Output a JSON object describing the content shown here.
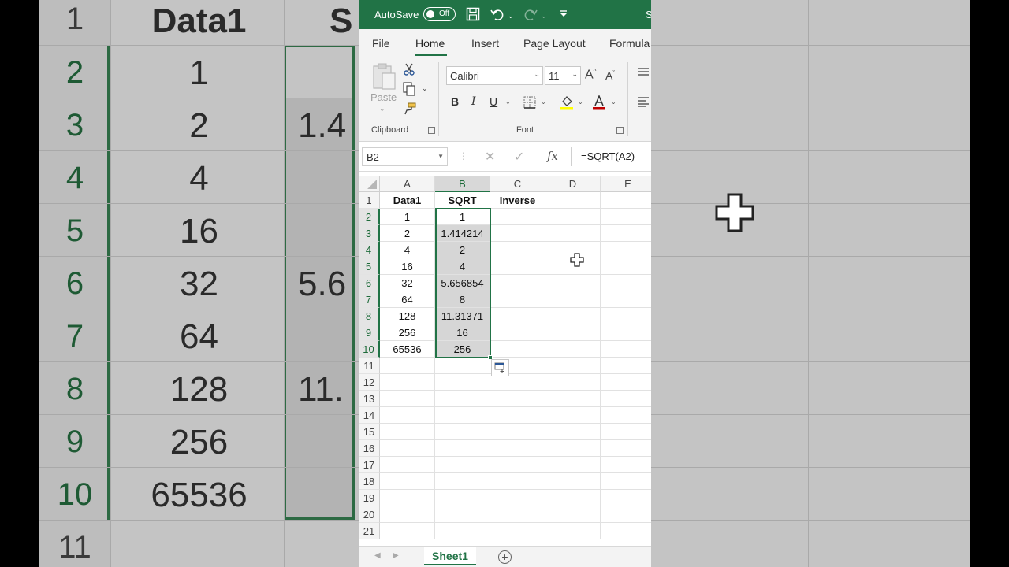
{
  "titlebar": {
    "autosave_label": "AutoSave",
    "toggle_state": "Off",
    "title_fragment": "S"
  },
  "tabs": [
    {
      "label": "File"
    },
    {
      "label": "Home"
    },
    {
      "label": "Insert"
    },
    {
      "label": "Page Layout"
    },
    {
      "label": "Formula"
    }
  ],
  "ribbon": {
    "paste_label": "Paste",
    "clipboard_label": "Clipboard",
    "font_label": "Font",
    "font_name": "Calibri",
    "font_size": "11",
    "bold": "B",
    "italic": "I",
    "underline": "U",
    "grow_font": "A",
    "shrink_font": "A"
  },
  "formula_bar": {
    "name_box": "B2",
    "fx": "fx",
    "formula": "=SQRT(A2)"
  },
  "grid": {
    "columns": [
      "A",
      "B",
      "C",
      "D",
      "E"
    ],
    "rows": [
      "1",
      "2",
      "3",
      "4",
      "5",
      "6",
      "7",
      "8",
      "9",
      "10",
      "11",
      "12",
      "13",
      "14",
      "15",
      "16",
      "17",
      "18",
      "19",
      "20",
      "21"
    ],
    "headers": [
      "Data1",
      "SQRT",
      "Inverse"
    ],
    "data": [
      [
        "1",
        "1"
      ],
      [
        "2",
        "1.414214"
      ],
      [
        "4",
        "2"
      ],
      [
        "16",
        "4"
      ],
      [
        "32",
        "5.656854"
      ],
      [
        "64",
        "8"
      ],
      [
        "128",
        "11.31371"
      ],
      [
        "256",
        "16"
      ],
      [
        "65536",
        "256"
      ]
    ]
  },
  "sheet": {
    "active_sheet": "Sheet1"
  },
  "background": {
    "row_numbers": [
      "1",
      "2",
      "3",
      "4",
      "5",
      "6",
      "7",
      "8",
      "9",
      "10",
      "11"
    ],
    "col_a": [
      "Data1",
      "1",
      "2",
      "4",
      "16",
      "32",
      "64",
      "128",
      "256",
      "65536"
    ],
    "col_b_fragments": [
      "S",
      "1.4",
      "5.6",
      "11."
    ]
  }
}
